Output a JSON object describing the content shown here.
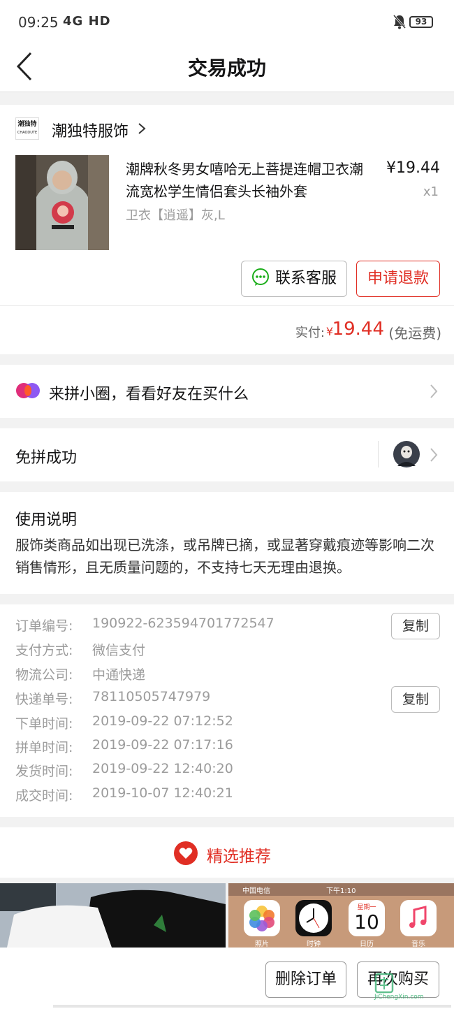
{
  "status_bar": {
    "time": "09:25",
    "signal": "4G HD",
    "battery": "93"
  },
  "nav": {
    "title": "交易成功"
  },
  "shop": {
    "logo_text_top": "潮独特",
    "logo_text_bottom": "CHAODUTE",
    "name": "潮独特服饰"
  },
  "product": {
    "title": "潮牌秋冬男女嘻哈无上菩提连帽卫衣潮流宽松学生情侣套头长袖外套",
    "sku": "卫衣【逍遥】灰,L",
    "price": "¥19.44",
    "qty": "x1"
  },
  "actions": {
    "contact": "联系客服",
    "refund": "申请退款"
  },
  "payment": {
    "label": "实付:",
    "currency": "¥",
    "amount": "19.44",
    "note": "(免运费)"
  },
  "circle": {
    "text": "来拼小圈，看看好友在买什么"
  },
  "group": {
    "text": "免拼成功"
  },
  "usage": {
    "title": "使用说明",
    "text": "服饰类商品如出现已洗涤，或吊牌已摘，或显著穿戴痕迹等影响二次销售情形，且无质量问题的，不支持七天无理由退换。"
  },
  "order_info": [
    {
      "label": "订单编号:",
      "value": "190922-623594701772547"
    },
    {
      "label": "支付方式:",
      "value": "微信支付"
    },
    {
      "label": "物流公司:",
      "value": "中通快递"
    },
    {
      "label": "快递单号:",
      "value": "78110505747979"
    },
    {
      "label": "下单时间:",
      "value": "2019-09-22 07:12:52"
    },
    {
      "label": "拼单时间:",
      "value": "2019-09-22 07:17:16"
    },
    {
      "label": "发货时间:",
      "value": "2019-09-22 12:40:20"
    },
    {
      "label": "成交时间:",
      "value": "2019-10-07 12:40:21"
    }
  ],
  "copy_label": "复制",
  "recommend": {
    "title": "精选推荐"
  },
  "recommend_thumb2": {
    "carrier": "中国电信",
    "time": "下午1:10",
    "apps": [
      "照片",
      "时钟",
      "日历",
      "音乐"
    ],
    "calendar_day": "星期一",
    "calendar_date": "10"
  },
  "bottom": {
    "delete": "删除订单",
    "rebuy": "再次购买"
  },
  "watermark": {
    "text": "JiChengXin.com"
  },
  "colors": {
    "accent": "#e02e24",
    "text": "#151516",
    "muted": "#9c9c9c",
    "bg": "#f2f2f2"
  }
}
